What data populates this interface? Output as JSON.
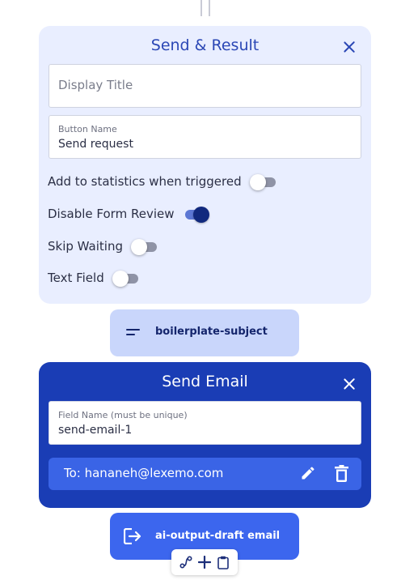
{
  "result_card": {
    "title": "Send & Result",
    "display_title": {
      "placeholder": "Display Title",
      "value": ""
    },
    "button_name": {
      "label": "Button Name",
      "value": "Send request"
    },
    "toggles": [
      {
        "label": "Add to statistics when triggered",
        "on": false
      },
      {
        "label": "Disable Form Review",
        "on": true
      },
      {
        "label": "Skip Waiting",
        "on": false
      },
      {
        "label": "Text Field",
        "on": false
      }
    ]
  },
  "subject_node": {
    "label": "boilerplate-subject",
    "icon": "short-text-icon"
  },
  "email_card": {
    "title": "Send Email",
    "field_name": {
      "label": "Field Name (must be unique)",
      "value": "send-email-1"
    },
    "recipient": "To: hananeh@lexemo.com"
  },
  "ai_node": {
    "label": "ai-output-draft email",
    "icon": "exit-arrow-icon"
  },
  "toolbar": {
    "icons": [
      "route-icon",
      "plus-icon",
      "clipboard-icon"
    ]
  },
  "colors": {
    "result_card_bg": "#e9eeff",
    "accent_dark": "#1a3db5",
    "accent_mid": "#3c66ee",
    "pill_light": "#c9d6fb"
  }
}
